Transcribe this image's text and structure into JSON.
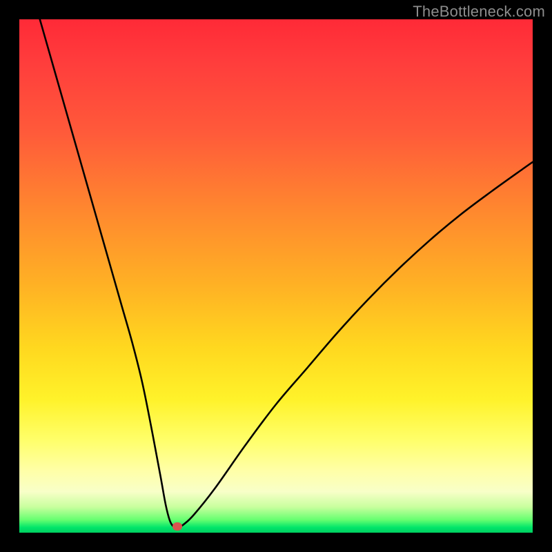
{
  "watermark": "TheBottleneck.com",
  "colors": {
    "curve": "#000000",
    "marker": "#d9544f",
    "frame": "#000000"
  },
  "chart_data": {
    "type": "line",
    "title": "",
    "xlabel": "",
    "ylabel": "",
    "xlim": [
      0,
      100
    ],
    "ylim": [
      0,
      100
    ],
    "grid": false,
    "legend": false,
    "series": [
      {
        "name": "bottleneck-curve",
        "x": [
          4,
          6,
          8,
          10,
          12,
          14,
          16,
          18,
          20,
          22,
          24,
          26,
          27.5,
          28.5,
          29.3,
          30,
          30.5,
          31,
          32,
          34,
          38,
          44,
          50,
          56,
          62,
          68,
          74,
          80,
          86,
          92,
          98,
          100
        ],
        "y": [
          100,
          93,
          86,
          79,
          72,
          65,
          58,
          51,
          44,
          37,
          29,
          19,
          11,
          5.5,
          2.4,
          1.2,
          1.0,
          1.0,
          1.6,
          3.5,
          8.5,
          17,
          25,
          32,
          39,
          45.5,
          51.5,
          57,
          62,
          66.5,
          70.8,
          72.2
        ]
      }
    ],
    "annotations": [
      {
        "name": "optimal-point",
        "x": 30.8,
        "y": 1.2
      }
    ]
  }
}
